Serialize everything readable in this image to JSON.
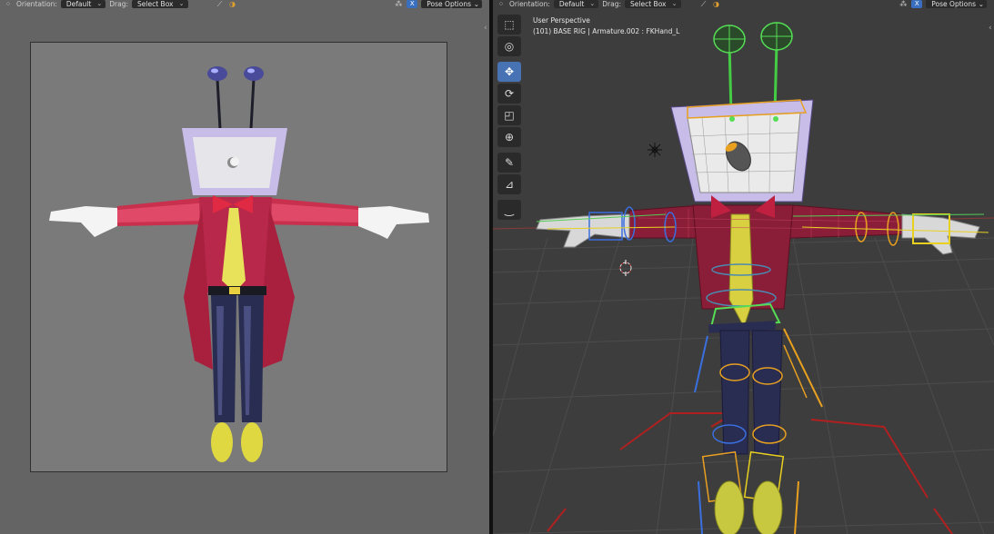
{
  "left_header": {
    "orientation_label": "Orientation:",
    "orientation_value": "Default",
    "drag_label": "Drag:",
    "drag_value": "Select Box",
    "pose_options": "Pose Options",
    "x_mirror": "X"
  },
  "right_header": {
    "orientation_label": "Orientation:",
    "orientation_value": "Default",
    "drag_label": "Drag:",
    "drag_value": "Select Box",
    "pose_options": "Pose Options",
    "x_mirror": "X"
  },
  "viewport": {
    "perspective": "User Perspective",
    "context": "(101) BASE RIG | Armature.002 : FKHand_L"
  },
  "toolbar": {
    "tools": [
      "select-box",
      "cursor",
      "move",
      "rotate",
      "scale",
      "transform",
      "annotate",
      "measure",
      "relax"
    ],
    "active": "move"
  },
  "colors": {
    "accent": "#4772b3",
    "suit_red": "#c9304e",
    "tie_yellow": "#e8e15a",
    "pants_navy": "#2a2d52",
    "head_lilac": "#c8bde8"
  }
}
